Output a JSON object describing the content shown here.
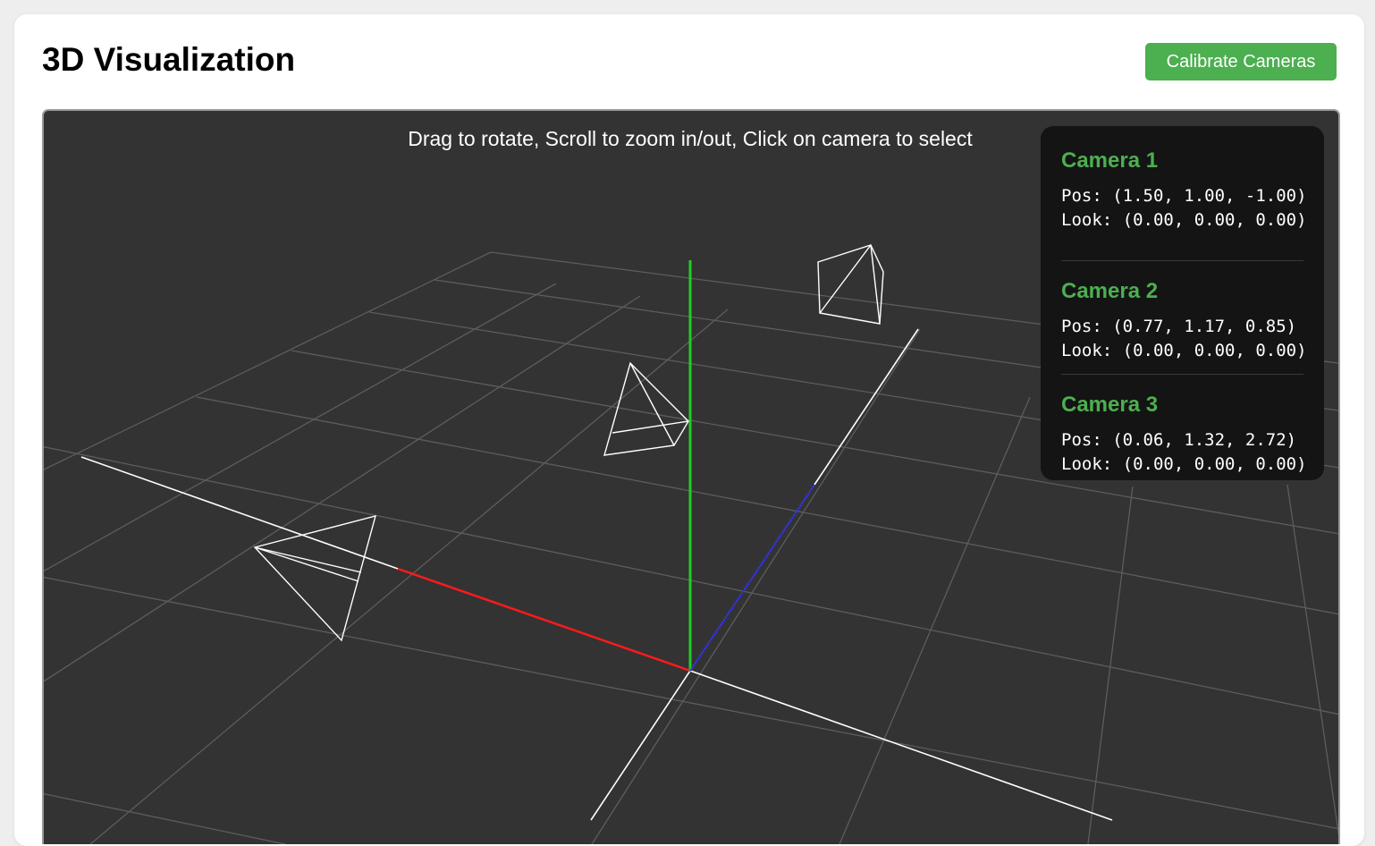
{
  "header": {
    "title": "3D Visualization",
    "calibrate_label": "Calibrate Cameras"
  },
  "viewport": {
    "instructions": "Drag to rotate, Scroll to zoom in/out, Click on camera to select",
    "background_color": "#333333",
    "axis_colors": {
      "x": "#ff0000",
      "y": "#00cc00",
      "z": "#0000ff"
    }
  },
  "cameras": [
    {
      "name": "Camera 1",
      "pos": "Pos: (1.50, 1.00, -1.00)",
      "look": "Look: (0.00, 0.00, 0.00)"
    },
    {
      "name": "Camera 2",
      "pos": "Pos: (0.77, 1.17, 0.85)",
      "look": "Look: (0.00, 0.00, 0.00)"
    },
    {
      "name": "Camera 3",
      "pos": "Pos: (0.06, 1.32, 2.72)",
      "look": "Look: (0.00, 0.00, 0.00)"
    }
  ],
  "colors": {
    "accent": "#4caf50",
    "panel_bg": "#141414"
  }
}
